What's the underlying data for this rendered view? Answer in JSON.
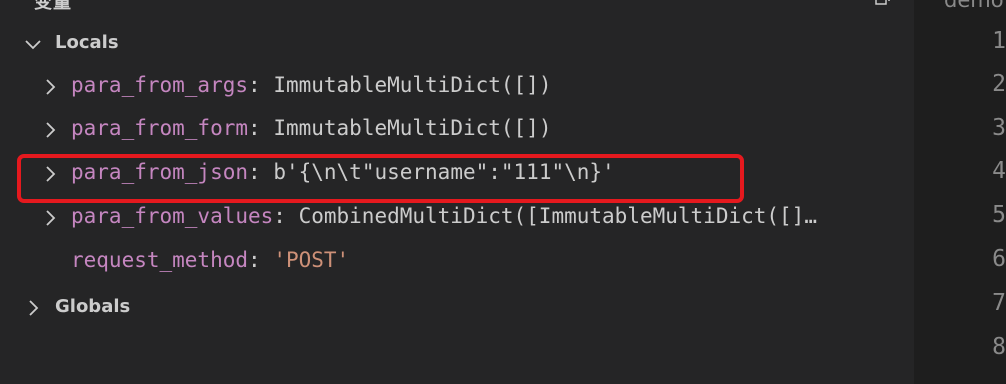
{
  "panel": {
    "title": "变量",
    "header_icon": "collapse-all-icon"
  },
  "scopes": {
    "locals": {
      "label": "Locals",
      "expanded": true,
      "variables": [
        {
          "name": "para_from_args",
          "value": "ImmutableMultiDict([])",
          "expandable": true
        },
        {
          "name": "para_from_form",
          "value": "ImmutableMultiDict([])",
          "expandable": true
        },
        {
          "name": "para_from_json",
          "value": "b'{\\n\\t\"username\":\"111\"\\n}'",
          "expandable": true
        },
        {
          "name": "para_from_values",
          "value": "CombinedMultiDict([ImmutableMultiDict([]…",
          "expandable": true
        },
        {
          "name": "request_method",
          "value": "'POST'",
          "expandable": false
        }
      ]
    },
    "globals": {
      "label": "Globals",
      "expanded": false
    }
  },
  "editor": {
    "tab_label": "demo",
    "line_numbers": [
      "1",
      "2",
      "3",
      "4",
      "5",
      "6",
      "7",
      "8"
    ]
  },
  "colors": {
    "variable_name": "#c586c0",
    "string_value": "#ce9178",
    "highlight_border": "#e5191e"
  }
}
